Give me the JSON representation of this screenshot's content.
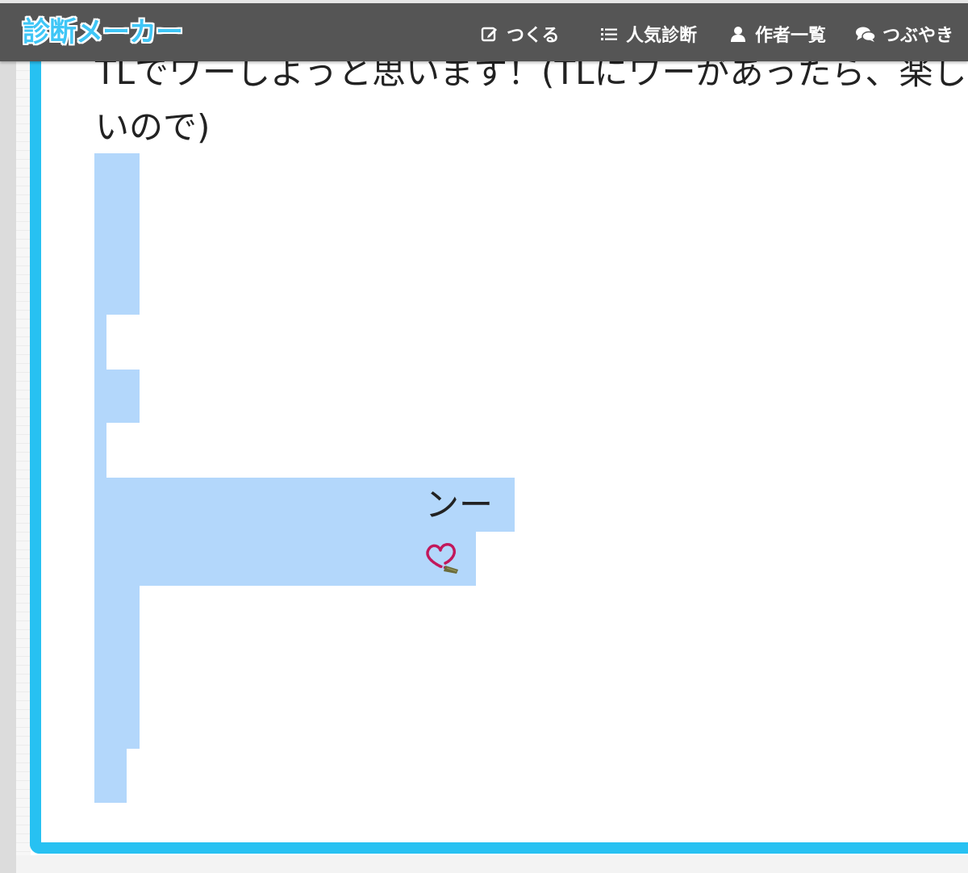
{
  "header": {
    "logo": "診断メーカー",
    "nav": [
      {
        "label": "つくる",
        "icon": "edit-icon"
      },
      {
        "label": "人気診断",
        "icon": "list-icon"
      },
      {
        "label": "作者一覧",
        "icon": "user-icon"
      },
      {
        "label": "つぶやき",
        "icon": "comments-icon"
      }
    ]
  },
  "result": {
    "text": "TLでワーしようと思います！(TLにワーがあったら、楽しいので)",
    "selected_text": "ンー",
    "emoji_icon": "prayer-beads-icon"
  },
  "colors": {
    "header_bg": "#555555",
    "accent_border": "#27c1f2",
    "logo": "#3fc6f6",
    "selection": "#b3d7fb"
  }
}
